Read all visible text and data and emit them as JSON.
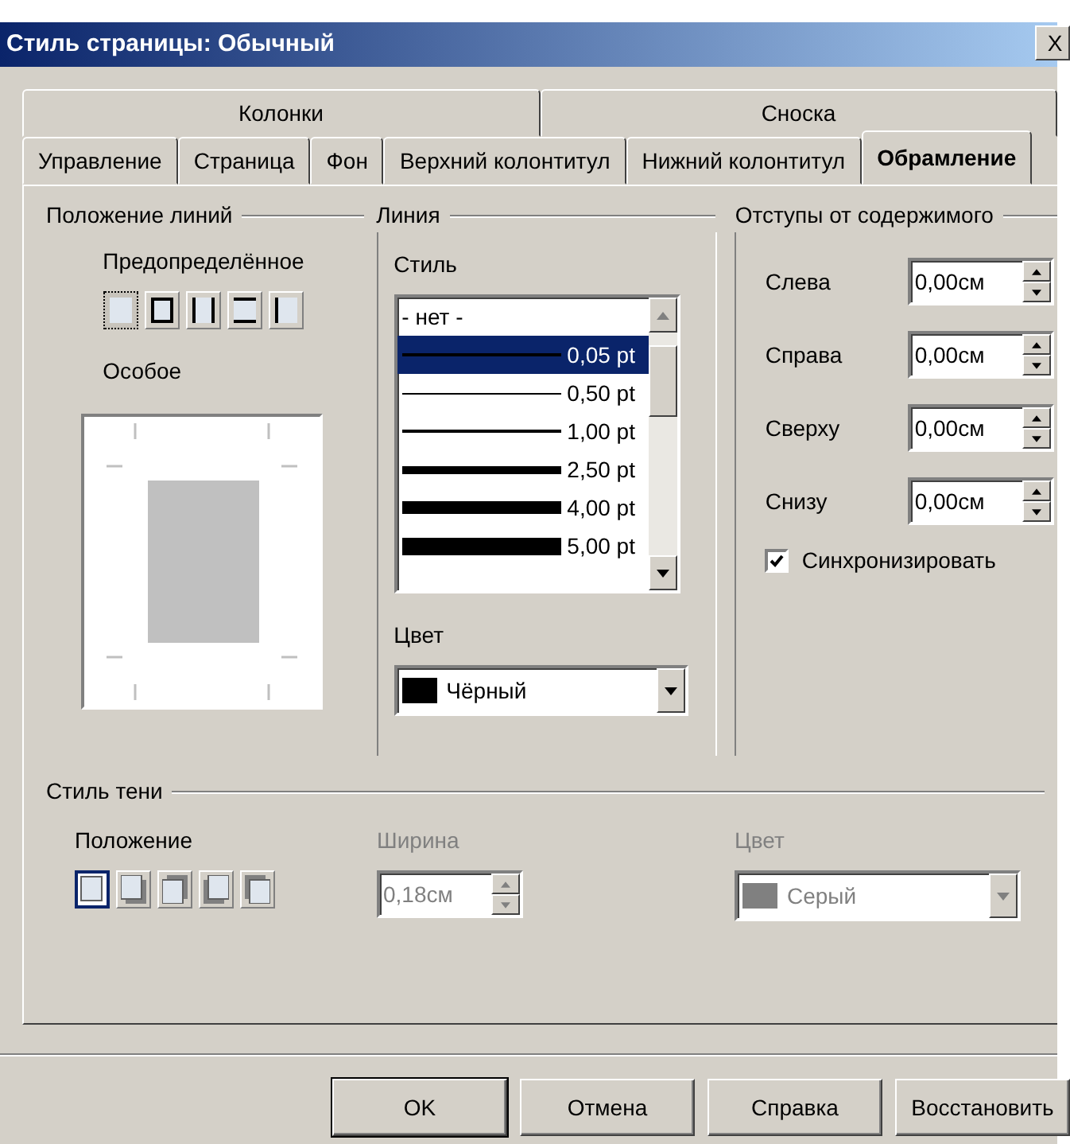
{
  "window": {
    "title": "Стиль страницы: Обычный",
    "close": "X"
  },
  "tab_rows": [
    [
      {
        "label": "Колонки",
        "selected": false
      },
      {
        "label": "Сноска",
        "selected": false
      }
    ],
    [
      {
        "label": "Управление",
        "selected": false
      },
      {
        "label": "Страница",
        "selected": false
      },
      {
        "label": "Фон",
        "selected": false
      },
      {
        "label": "Верхний колонтитул",
        "selected": false
      },
      {
        "label": "Нижний колонтитул",
        "selected": false
      },
      {
        "label": "Обрамление",
        "selected": true
      }
    ]
  ],
  "line_position": {
    "title": "Положение линий",
    "predefined_label": "Предопределённое",
    "presets": [
      {
        "kind": "none",
        "selected": true
      },
      {
        "kind": "box",
        "selected": false
      },
      {
        "kind": "left-right",
        "selected": false
      },
      {
        "kind": "top-bottom",
        "selected": false
      },
      {
        "kind": "left",
        "selected": false
      }
    ],
    "custom_label": "Особое"
  },
  "line": {
    "title": "Линия",
    "style_label": "Стиль",
    "styles": [
      {
        "label": "- нет -",
        "kind": "none",
        "selected": false
      },
      {
        "label": "0,05 pt",
        "kind": "hairline",
        "selected": true
      },
      {
        "label": "0,50 pt",
        "kind": "thin",
        "selected": false
      },
      {
        "label": "1,00 pt",
        "kind": "medium",
        "selected": false
      },
      {
        "label": "2,50 pt",
        "kind": "thick",
        "selected": false
      },
      {
        "label": "4,00 pt",
        "kind": "heavy",
        "selected": false
      },
      {
        "label": "5,00 pt",
        "kind": "extra-heavy",
        "selected": false
      }
    ],
    "color_label": "Цвет",
    "color": {
      "value": "Чёрный",
      "color": "#000000"
    }
  },
  "spacing": {
    "title": "Отступы от содержимого",
    "fields": [
      {
        "label": "Слева",
        "value": "0,00см"
      },
      {
        "label": "Справа",
        "value": "0,00см"
      },
      {
        "label": "Сверху",
        "value": "0,00см"
      },
      {
        "label": "Снизу",
        "value": "0,00см"
      }
    ],
    "sync": {
      "label": "Синхронизировать",
      "checked": true
    }
  },
  "shadow": {
    "title": "Стиль тени",
    "position_label": "Положение",
    "presets": [
      {
        "kind": "none",
        "selected": true
      },
      {
        "kind": "bottom-right",
        "selected": false
      },
      {
        "kind": "top-right",
        "selected": false
      },
      {
        "kind": "bottom-left",
        "selected": false
      },
      {
        "kind": "top-left",
        "selected": false
      }
    ],
    "width_label": "Ширина",
    "width": {
      "value": "0,18см",
      "disabled": true
    },
    "color_label": "Цвет",
    "color": {
      "value": "Серый",
      "color": "#808080",
      "disabled": true
    }
  },
  "buttons": [
    {
      "label": "OK"
    },
    {
      "label": "Отмена"
    },
    {
      "label": "Справка"
    },
    {
      "label": "Восстановить"
    }
  ]
}
